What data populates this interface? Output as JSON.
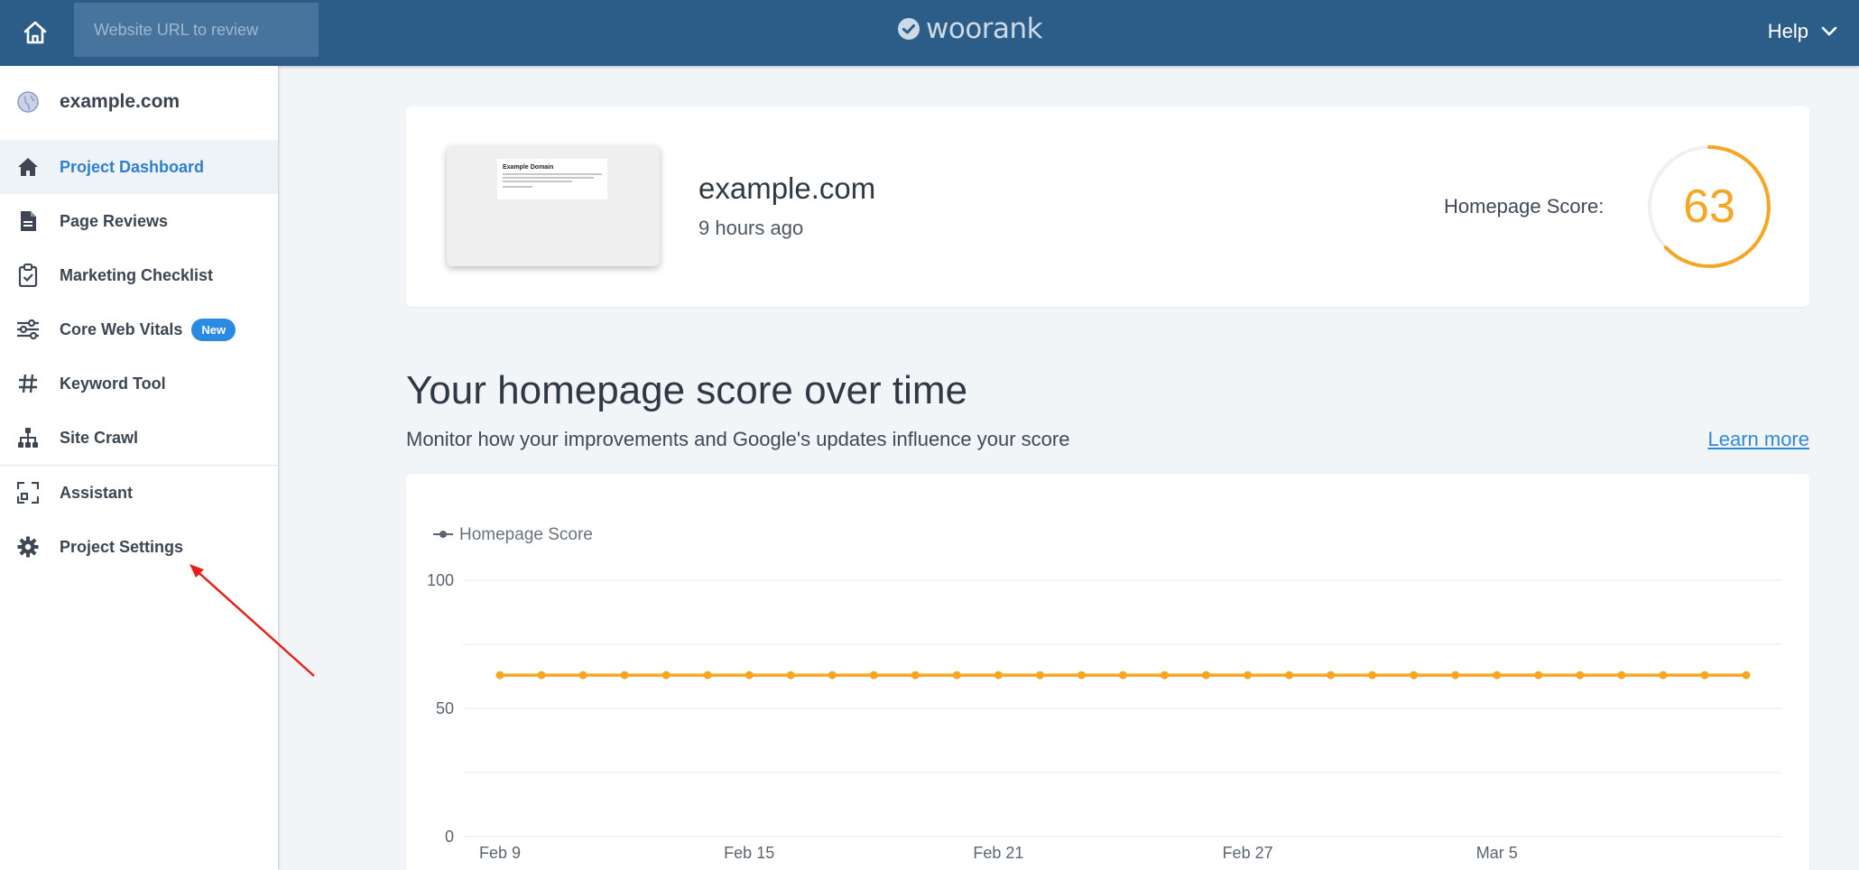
{
  "topbar": {
    "url_placeholder": "Website URL to review",
    "logo_text": "woorank",
    "help_label": "Help"
  },
  "sidebar": {
    "project": "example.com",
    "items": [
      {
        "label": "Project Dashboard",
        "icon": "home-icon",
        "active": true
      },
      {
        "label": "Page Reviews",
        "icon": "document-icon"
      },
      {
        "label": "Marketing Checklist",
        "icon": "clipboard-check-icon"
      },
      {
        "label": "Core Web Vitals",
        "icon": "sliders-icon",
        "badge": "New"
      },
      {
        "label": "Keyword Tool",
        "icon": "hashtag-icon"
      },
      {
        "label": "Site Crawl",
        "icon": "sitemap-icon"
      },
      {
        "label": "Assistant",
        "icon": "scan-icon"
      },
      {
        "label": "Project Settings",
        "icon": "gear-icon"
      }
    ]
  },
  "project_card": {
    "thumbnail_title": "Example Domain",
    "site": "example.com",
    "time": "9 hours ago",
    "score_label": "Homepage Score:",
    "score": "63"
  },
  "section": {
    "title": "Your homepage score over time",
    "subtitle": "Monitor how your improvements and Google's updates influence your score",
    "learn_more": "Learn more"
  },
  "colors": {
    "topbar": "#2c5d88",
    "accent_blue": "#2f7fd1",
    "score_orange": "#f5a623"
  },
  "chart_data": {
    "type": "line",
    "title": "",
    "xlabel": "",
    "ylabel": "",
    "ylim": [
      0,
      100
    ],
    "yticks": [
      0,
      50,
      100
    ],
    "grid": true,
    "legend": "top-left",
    "x_tick_labels": [
      "Feb 9",
      "Feb 15",
      "Feb 21",
      "Feb 27",
      "Mar 5"
    ],
    "x": [
      "Feb 9",
      "Feb 10",
      "Feb 11",
      "Feb 12",
      "Feb 13",
      "Feb 14",
      "Feb 15",
      "Feb 16",
      "Feb 17",
      "Feb 18",
      "Feb 19",
      "Feb 20",
      "Feb 21",
      "Feb 22",
      "Feb 23",
      "Feb 24",
      "Feb 25",
      "Feb 26",
      "Feb 27",
      "Feb 28",
      "Mar 1",
      "Mar 2",
      "Mar 3",
      "Mar 4",
      "Mar 5",
      "Mar 6",
      "Mar 7",
      "Mar 8",
      "Mar 9",
      "Mar 10",
      "Mar 11"
    ],
    "series": [
      {
        "name": "Homepage Score",
        "color": "#f5a623",
        "values": [
          63,
          63,
          63,
          63,
          63,
          63,
          63,
          63,
          63,
          63,
          63,
          63,
          63,
          63,
          63,
          63,
          63,
          63,
          63,
          63,
          63,
          63,
          63,
          63,
          63,
          63,
          63,
          63,
          63,
          63,
          63
        ]
      }
    ]
  }
}
